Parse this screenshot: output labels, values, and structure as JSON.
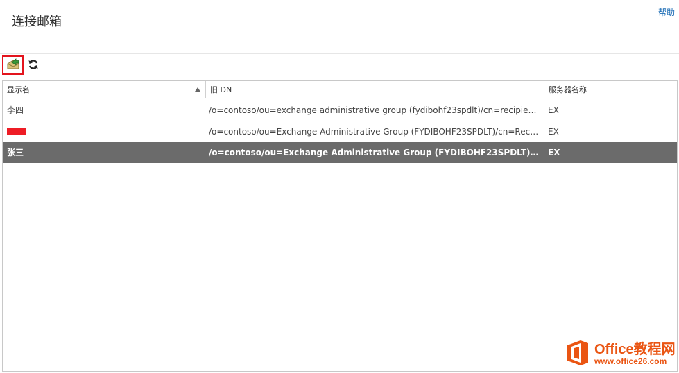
{
  "page": {
    "title": "连接邮箱",
    "help_link": "帮助"
  },
  "toolbar": {
    "connect_icon": "connect-mailbox-icon",
    "refresh_icon": "refresh-icon",
    "connect_highlight_color": "#e3141d"
  },
  "table": {
    "columns": [
      {
        "label": "显示名",
        "sorted": "ascending"
      },
      {
        "label": "旧 DN"
      },
      {
        "label": "服务器名称"
      }
    ],
    "rows": [
      {
        "display_name": "李四",
        "legacy_dn": "/o=contoso/ou=exchange administrative group (fydibohf23spdlt)/cn=recipients/cn=us...",
        "server": "EX",
        "selected": false
      },
      {
        "display_name": "",
        "display_name_redacted": true,
        "legacy_dn": "/o=contoso/ou=Exchange Administrative Group (FYDIBOHF23SPDLT)/cn=Recipients/cn...",
        "server": "EX",
        "selected": false
      },
      {
        "display_name": "张三",
        "legacy_dn": "/o=contoso/ou=Exchange Administrative Group (FYDIBOHF23SPDLT)/cn=Recipients...",
        "server": "EX",
        "selected": true
      }
    ],
    "selected_row_color": "#6b6b6b"
  },
  "watermark": {
    "brand": "Office教程网",
    "url": "www.office26.com",
    "color": "#ea5513"
  }
}
